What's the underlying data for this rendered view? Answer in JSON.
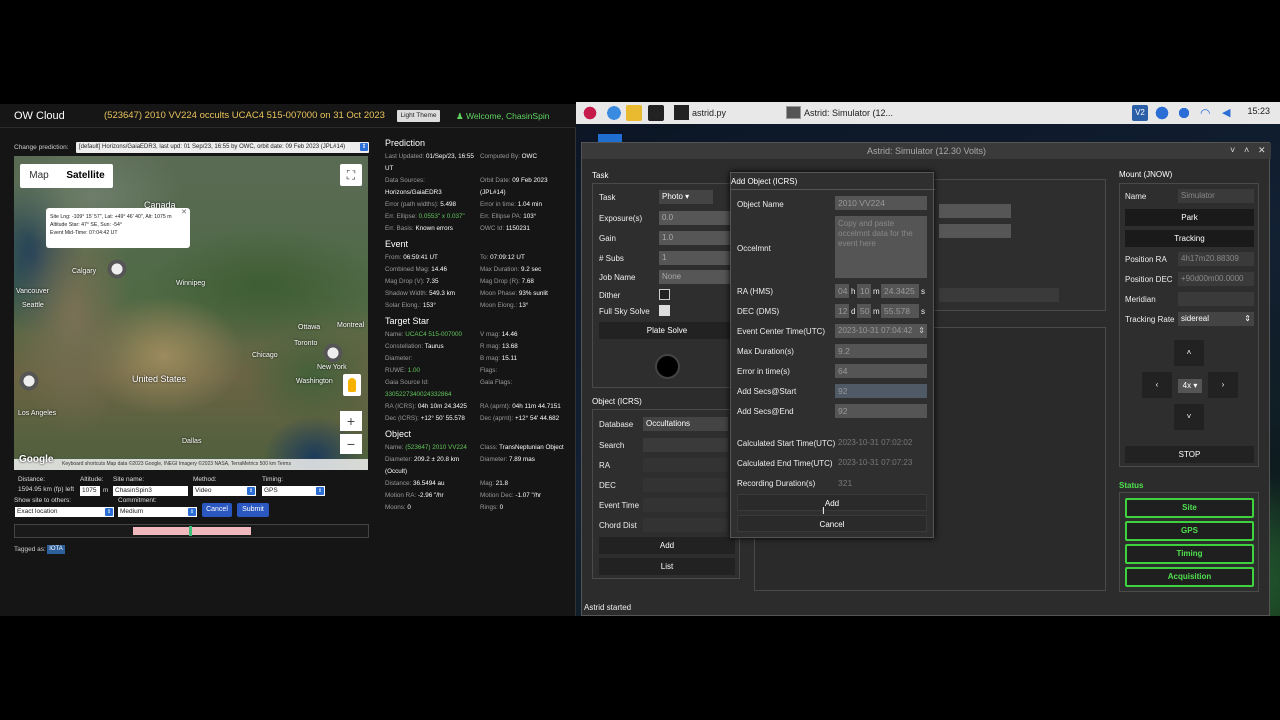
{
  "owc": {
    "logo": "OW Cloud",
    "title": "(523647) 2010 VV224 occults UCAC4 515-007000 on 31 Oct 2023",
    "theme_button": "Light Theme",
    "welcome": "Welcome, ChasinSpin",
    "change_prediction_label": "Change prediction:",
    "prediction_select": "[default] Horizons/GaiaEDR3, last upd: 01 Sep/23, 16:55 by OWC, orbit date: 09 Feb 2023 (JPL#14)",
    "map": {
      "tab_map": "Map",
      "tab_satellite": "Satellite",
      "info": {
        "line1": "Site Lng: -109° 15' 57\", Lat: +49° 46' 40\", Alt: 1075 m",
        "line2": "Altitude Star: 47° SE, Sun: -54°",
        "line3": "Event Mid-Time: 07:04:42 UT"
      },
      "labels": [
        "Canada",
        "Calgary",
        "Winnipeg",
        "Vancouver",
        "Seattle",
        "Ottawa",
        "Montreal",
        "Toronto",
        "Chicago",
        "United States",
        "Washington",
        "New York",
        "Los Angeles",
        "Dallas"
      ],
      "google": "Google",
      "footer": "Keyboard shortcuts   Map data ©2023 Google, INEGI Imagery ©2023 NASA, TerraMetrics   500 km   Terms"
    },
    "form": {
      "distance_label": "Distance:",
      "distance_value": "1594.95 km (fp) left",
      "altitude_label": "Altitude:",
      "altitude_value": "1075",
      "altitude_unit": "m",
      "site_name_label": "Site name:",
      "site_name_value": "ChasinSpin3",
      "method_label": "Method:",
      "method_value": "Video",
      "timing_label": "Timing:",
      "timing_value": "GPS",
      "show_site_label": "Show site to others:",
      "show_site_value": "Exact location",
      "commitment_label": "Commitment:",
      "commitment_value": "Medium",
      "cancel": "Cancel",
      "submit": "Submit"
    },
    "tagged_label": "Tagged as:",
    "tag": "IOTA",
    "prediction": {
      "header": "Prediction",
      "rows": [
        [
          "Last Updated:",
          "01/Sep/23, 16:55 UT",
          "Computed By:",
          "OWC"
        ],
        [
          "Data Sources:",
          "Horizons/GaiaEDR3",
          "Orbit Date:",
          "09 Feb 2023 (JPL#14)"
        ],
        [
          "Error (path widths):",
          "5.498",
          "Error in time:",
          "1.04 min"
        ],
        [
          "Err. Ellipse:",
          "0.0553\" x 0.037\"",
          "Err. Ellipse PA:",
          "103°"
        ],
        [
          "Err. Basis:",
          "Known errors",
          "OWC Id:",
          "1150231"
        ]
      ]
    },
    "event": {
      "header": "Event",
      "rows": [
        [
          "From:",
          "06:59:41 UT",
          "To:",
          "07:09:12 UT"
        ],
        [
          "Combined Mag:",
          "14.46",
          "Max Duration:",
          "9.2 sec"
        ],
        [
          "Mag Drop (V):",
          "7.35",
          "Mag Drop (R):",
          "7.68"
        ],
        [
          "Shadow Width:",
          "549.3 km",
          "Moon Phase:",
          "93% sunlit"
        ],
        [
          "Solar Elong.:",
          "153°",
          "Moon Elong.:",
          "13°"
        ]
      ]
    },
    "target_star": {
      "header": "Target Star",
      "rows": [
        [
          "Name:",
          "UCAC4 515-007000",
          "V mag:",
          "14.46"
        ],
        [
          "Constellation:",
          "Taurus",
          "R mag:",
          "13.68"
        ],
        [
          "Diameter:",
          "",
          "B mag:",
          "15.11"
        ],
        [
          "RUWE:",
          "1.00",
          "Flags:",
          ""
        ],
        [
          "Gaia Source Id:",
          "3305227340024332864",
          "Gaia Flags:",
          ""
        ],
        [
          "RA (ICRS):",
          "04h 10m 24.3425",
          "RA (aprnt):",
          "04h 11m 44.7151"
        ],
        [
          "Dec (ICRS):",
          "+12° 50' 55.578",
          "Dec (aprnt):",
          "+12° 54' 44.682"
        ]
      ]
    },
    "object": {
      "header": "Object",
      "rows": [
        [
          "Name:",
          "(523647) 2010 VV224",
          "Class:",
          "TransNeptunian Object"
        ],
        [
          "Diameter:",
          "209.2 ± 20.8 km (Occult)",
          "Diameter:",
          "7.89 mas"
        ],
        [
          "Distance:",
          "36.5494 au",
          "Mag:",
          "21.8"
        ],
        [
          "Motion RA:",
          "-2.96 \"/hr",
          "Motion Dec:",
          "-1.07 \"/hr"
        ],
        [
          "Moons:",
          "0",
          "Rings:",
          "0"
        ]
      ]
    }
  },
  "desktop": {
    "taskbar": {
      "task_terminal": "astrid.py",
      "task_astrid": "Astrid: Simulator (12...",
      "clock": "15:23"
    }
  },
  "astrid": {
    "title": "Astrid: Simulator (12.30 Volts)",
    "status_bar": "Astrid started",
    "task": {
      "header": "Task",
      "task_label": "Task",
      "task_value": "Photo",
      "exposure_label": "Exposure(s)",
      "exposure_value": "0.0",
      "gain_label": "Gain",
      "gain_value": "1.0",
      "subs_label": "# Subs",
      "subs_value": "1",
      "job_label": "Job Name",
      "job_value": "None",
      "dither_label": "Dither",
      "plate_label": "Full Sky Solve",
      "plate_button": "Plate Solve"
    },
    "object_panel": {
      "header": "Object (ICRS)",
      "database_label": "Database",
      "database_value": "Occultations",
      "search_label": "Search",
      "ra_label": "RA",
      "dec_label": "DEC",
      "event_time_label": "Event Time",
      "chord_label": "Chord Dist",
      "add": "Add",
      "list": "List"
    },
    "mount": {
      "header": "Mount (JNOW)",
      "name_label": "Name",
      "name_value": "Simulator",
      "park": "Park",
      "tracking": "Tracking",
      "pos_ra_label": "Position RA",
      "pos_ra_value": "4h17m20.88309",
      "pos_dec_label": "Position DEC",
      "pos_dec_value": "+90d00m00.0000",
      "meridian_label": "Meridian",
      "rate_label": "Tracking Rate",
      "rate_value": "sidereal",
      "speed": "4x",
      "stop": "STOP"
    },
    "status": {
      "header": "Status",
      "items": [
        "Site",
        "GPS",
        "Timing",
        "Acquisition"
      ]
    },
    "dialog": {
      "header": "Add Object (ICRS)",
      "object_name_label": "Object Name",
      "object_name_value": "2010 VV224",
      "occelmnt_label": "Occelmnt",
      "occelmnt_placeholder": "Copy and paste occelmnt data for the event here",
      "ra_label": "RA (HMS)",
      "ra_h": "04",
      "ra_m": "10",
      "ra_s": "24.3425",
      "dec_label": "DEC (DMS)",
      "dec_d": "12",
      "dec_m": "50",
      "dec_s": "55.578",
      "u_h": "h",
      "u_m": "m",
      "u_s": "s",
      "u_d": "d",
      "center_label": "Event Center Time(UTC)",
      "center_value": "2023-10-31 07:04:42",
      "maxdur_label": "Max Duration(s)",
      "maxdur_value": "9.2",
      "err_label": "Error in time(s)",
      "err_value": "64",
      "add_start_label": "Add Secs@Start",
      "add_start_value": "92",
      "add_end_label": "Add Secs@End",
      "add_end_value": "92",
      "calc_start_label": "Calculated Start Time(UTC)",
      "calc_start_value": "2023-10-31 07:02:02",
      "calc_end_label": "Calculated End Time(UTC)",
      "calc_end_value": "2023-10-31 07:07:23",
      "rec_label": "Recording Duration(s)",
      "rec_value": "321",
      "add": "Add",
      "cancel": "Cancel"
    }
  }
}
